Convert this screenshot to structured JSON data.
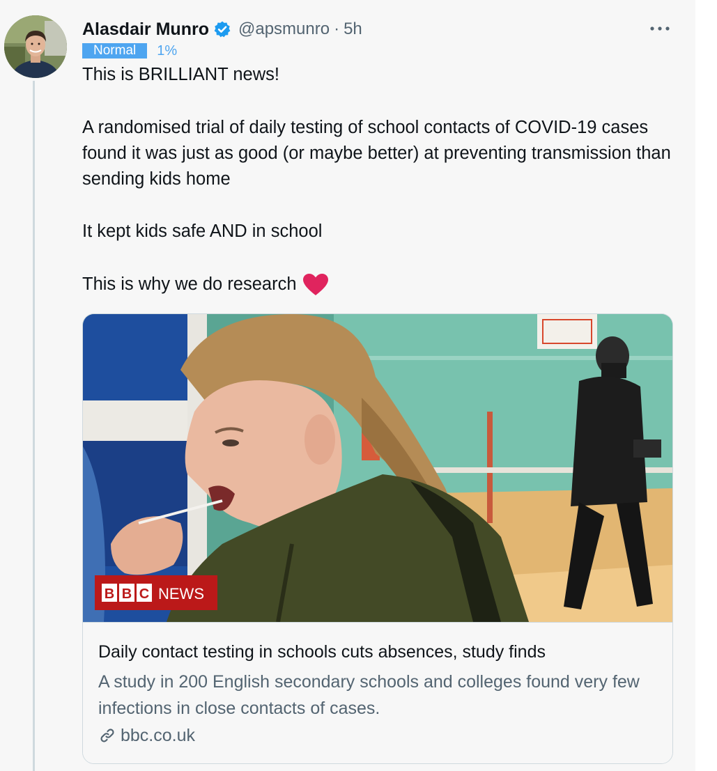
{
  "author": {
    "name": "Alasdair Munro",
    "handle": "@apsmunro",
    "separator": "·",
    "time": "5h"
  },
  "badge": {
    "label": "Normal",
    "percent": "1%"
  },
  "tweet": {
    "line1": "This is BRILLIANT news!",
    "para2": "A randomised trial of daily testing of school contacts of COVID-19 cases found it was just as good (or maybe better) at preventing transmission than sending kids home",
    "para3": "It kept kids safe AND in school",
    "para4": "This is why we do research",
    "emoji": "red-heart-icon"
  },
  "card": {
    "image_logo_letters": "BBC",
    "image_logo_word": "NEWS",
    "title": "Daily contact testing in schools cuts absences, study finds",
    "description": "A study in 200 English secondary schools and colleges found very few infections in close contacts of cases.",
    "domain": "bbc.co.uk"
  },
  "colors": {
    "accent": "#1d9bf0",
    "badge": "#4ea5f0",
    "heart": "#e0245e",
    "bbc_red": "#bb1919",
    "secondary_text": "#536471"
  }
}
